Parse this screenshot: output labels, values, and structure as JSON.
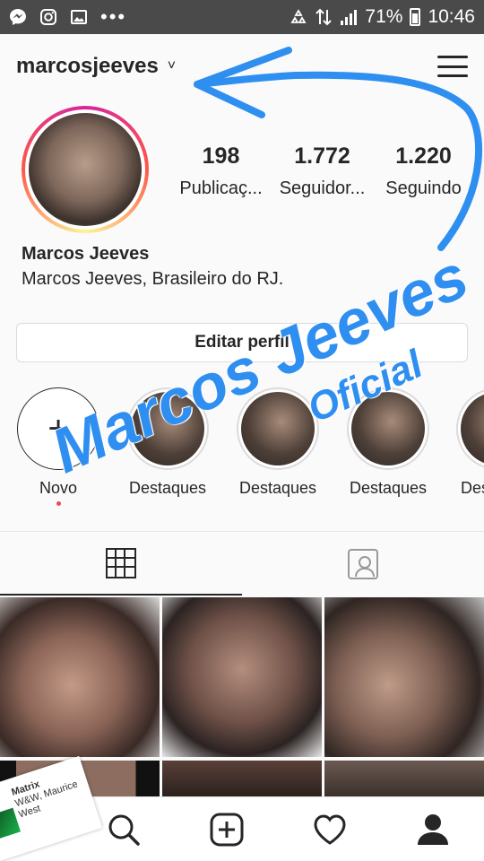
{
  "status_bar": {
    "battery": "71%",
    "time": "10:46",
    "dots": "•••"
  },
  "header": {
    "username": "marcosjeeves",
    "chevron": "˅"
  },
  "profile": {
    "stats": [
      {
        "value": "198",
        "label": "Publicaç..."
      },
      {
        "value": "1.772",
        "label": "Seguidor..."
      },
      {
        "value": "1.220",
        "label": "Seguindo"
      }
    ],
    "full_name": "Marcos Jeeves",
    "bio": "Marcos Jeeves, Brasileiro  do RJ.",
    "edit_button": "Editar perfil"
  },
  "highlights": [
    {
      "label": "Novo",
      "new": true
    },
    {
      "label": "Destaques"
    },
    {
      "label": "Destaques"
    },
    {
      "label": "Destaques"
    },
    {
      "label": "Des"
    }
  ],
  "new_highlight_plus": "+",
  "music_sticker": {
    "song": "Matrix",
    "artist": "W&W, Maurice West"
  },
  "overlay": {
    "line1": "Marcos Jeeves",
    "line2": "Oficial",
    "color": "#2f8ff0"
  }
}
